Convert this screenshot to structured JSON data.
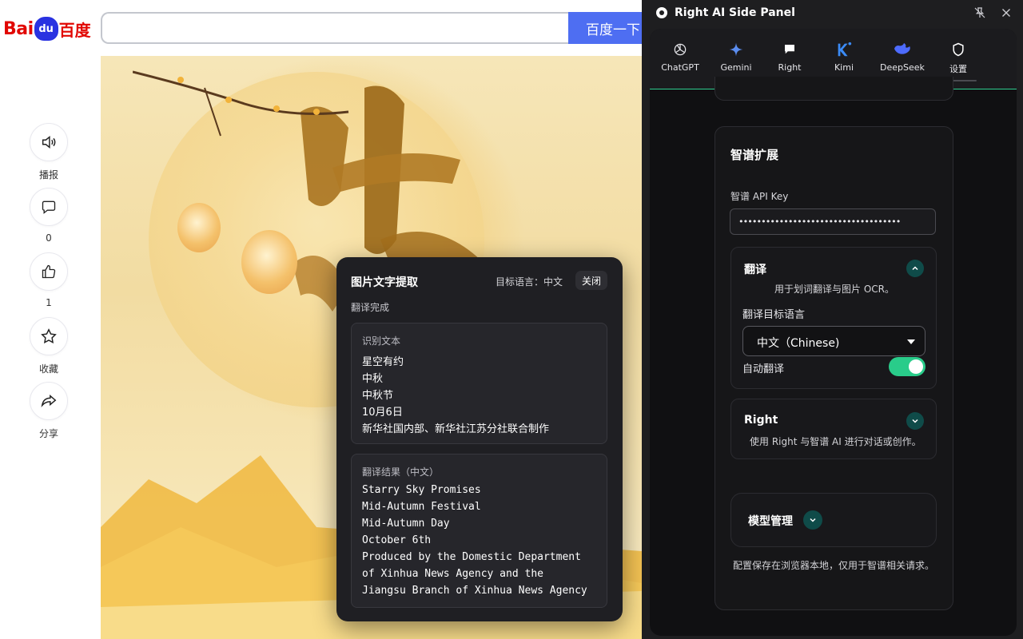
{
  "baidu": {
    "logo_left": "Bai",
    "logo_paw": "du",
    "logo_right": "百度",
    "search_value": "",
    "search_button": "百度一下",
    "actions": [
      {
        "name": "broadcast",
        "icon": "speaker-icon",
        "label": "播报"
      },
      {
        "name": "comment",
        "icon": "comment-icon",
        "label": "0"
      },
      {
        "name": "like",
        "icon": "thumbs-up-icon",
        "label": "1"
      },
      {
        "name": "favorite",
        "icon": "star-icon",
        "label": "收藏"
      },
      {
        "name": "share",
        "icon": "share-icon",
        "label": "分享"
      }
    ]
  },
  "ocr_popup": {
    "title": "图片文字提取",
    "target_language": "目标语言：中文",
    "close_label": "关闭",
    "status": "翻译完成",
    "recognized": {
      "header": "识别文本",
      "lines": [
        "星空有约",
        "中秋",
        "中秋节",
        "10月6日",
        "新华社国内部、新华社江苏分社联合制作"
      ]
    },
    "translation": {
      "header": "翻译结果（中文）",
      "lines": [
        "Starry Sky Promises",
        "Mid-Autumn Festival",
        "Mid-Autumn Day",
        "October 6th",
        "Produced by the Domestic Department",
        "of Xinhua News Agency and the",
        "Jiangsu Branch of Xinhua News Agency"
      ]
    }
  },
  "panel": {
    "title": "Right AI Side Panel",
    "tabs": [
      {
        "label": "ChatGPT",
        "icon": "chatgpt-icon"
      },
      {
        "label": "Gemini",
        "icon": "gemini-icon"
      },
      {
        "label": "Right",
        "icon": "chat-bubble-icon"
      },
      {
        "label": "Kimi",
        "icon": "kimi-icon"
      },
      {
        "label": "DeepSeek",
        "icon": "deepseek-icon"
      },
      {
        "label": "设置",
        "icon": "shield-icon"
      }
    ],
    "zhipu": {
      "title": "智谱扩展",
      "api_key_label": "智谱 API Key",
      "api_key_value": "••••••••••••••••••••••••••••••••••••",
      "translate": {
        "title": "翻译",
        "desc": "用于划词翻译与图片 OCR。",
        "target_label": "翻译目标语言",
        "target_value": "中文（Chinese)",
        "auto_label": "自动翻译",
        "auto_on": true
      },
      "right": {
        "title": "Right",
        "desc": "使用 Right 与智谱 AI 进行对话或创作。"
      },
      "models": {
        "title": "模型管理"
      },
      "footer": "配置保存在浏览器本地，仅用于智谱相关请求。"
    },
    "colors": {
      "accent": "#29cc8a",
      "chevron_bg": "#0f4b49",
      "divider": "#2ecf90"
    }
  }
}
